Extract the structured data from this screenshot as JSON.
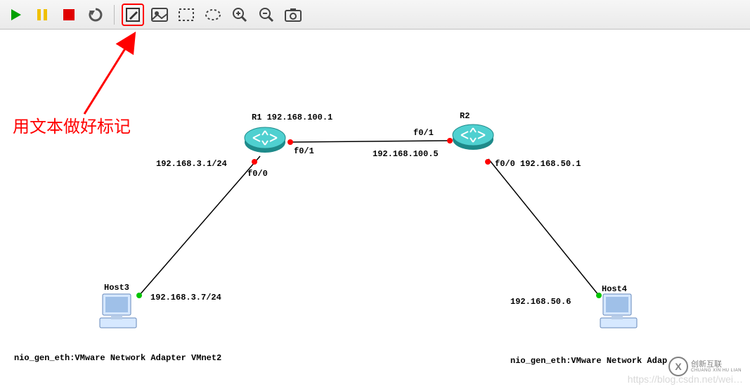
{
  "toolbar": {
    "play": "Play",
    "pause": "Pause",
    "stop": "Stop",
    "reload": "Reload",
    "text_note": "Add Text Note",
    "image": "Insert Image",
    "rect_select": "Rectangle Select",
    "ellipse_select": "Ellipse Select",
    "zoom_in": "Zoom In",
    "zoom_out": "Zoom Out",
    "screenshot": "Screenshot"
  },
  "annotation": "用文本做好标记",
  "devices": {
    "r1": {
      "name": "R1",
      "ip": "192.168.100.1"
    },
    "r2": {
      "name": "R2"
    },
    "host3": {
      "name": "Host3"
    },
    "host4": {
      "name": "Host4"
    }
  },
  "labels": {
    "r1_title": "R1  192.168.100.1",
    "r2_title": "R2",
    "r1_f01": "f0/1",
    "r2_f01": "f0/1",
    "link_ip": "192.168.100.5",
    "r1_lan": "192.168.3.1/24",
    "r1_f00": "f0/0",
    "r2_f00": "f0/0 192.168.50.1",
    "host3_name": "Host3",
    "host3_ip": "192.168.3.7/24",
    "host4_name": "Host4",
    "host4_ip": "192.168.50.6",
    "nic_left": "nio_gen_eth:VMware Network Adapter VMnet2",
    "nic_right": "nio_gen_eth:VMware Network Adap"
  },
  "watermark": "https://blog.csdn.net/wei…",
  "brand": {
    "glyph": "X",
    "line1": "创新互联",
    "line2": "CHUANG XIN HU LIAN"
  }
}
